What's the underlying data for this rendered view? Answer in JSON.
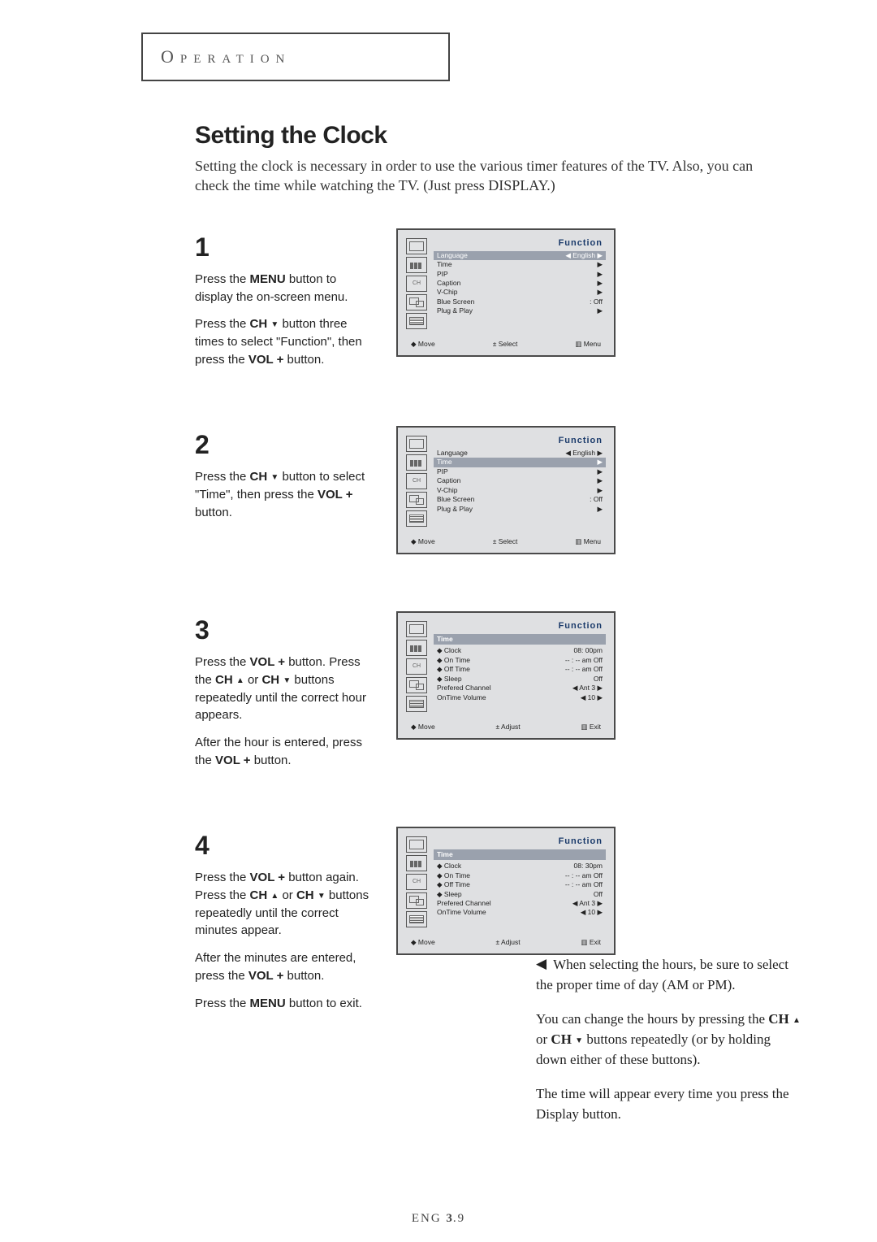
{
  "section_header": "Operation",
  "title": "Setting the Clock",
  "intro": "Setting the clock is necessary in order to use the various timer features of the TV. Also, you can check the time while watching the TV.  (Just press DISPLAY.)",
  "steps": {
    "s1": {
      "num": "1",
      "p1a": "Press the ",
      "menu": "MENU",
      "p1b": " button to display the on-screen menu.",
      "p2a": "Press the ",
      "ch": "CH ",
      "p2b": " button three times to select \"Function\",  then press the ",
      "vol": "VOL +",
      "p2c": " button."
    },
    "s2": {
      "num": "2",
      "p1a": "Press the ",
      "ch": "CH ",
      "p1b": " button to select \"Time\", then press the ",
      "vol": "VOL +",
      "p1c": " button."
    },
    "s3": {
      "num": "3",
      "p1a": "Press the ",
      "vol1": "VOL +",
      "p1b": " button. Press the ",
      "chup": "CH ",
      "or": " or ",
      "chdn": "CH ",
      "p1c": " buttons repeatedly until the correct hour appears.",
      "p2a": "After the hour is entered, press the ",
      "vol2": "VOL +",
      "p2b": " button."
    },
    "s4": {
      "num": "4",
      "p1a": "Press the ",
      "vol1": "VOL +",
      "p1b": " button again. Press the ",
      "chup": "CH ",
      "or": " or ",
      "chdn": "CH ",
      "p1c": " buttons repeatedly until the correct minutes appear.",
      "p2a": "After the minutes are entered, press the ",
      "vol2": "VOL +",
      "p2b": " button.",
      "p3a": "Press the ",
      "menu": "MENU",
      "p3b": " button to exit."
    }
  },
  "osd": {
    "title": "Function",
    "rows_fn": {
      "language": {
        "l": "Language",
        "r": "◀ English ▶"
      },
      "time": {
        "l": "Time",
        "r": "▶"
      },
      "pip": {
        "l": "PIP",
        "r": "▶"
      },
      "caption": {
        "l": "Caption",
        "r": "▶"
      },
      "vchip": {
        "l": "V-Chip",
        "r": "▶"
      },
      "blue": {
        "l": "Blue Screen",
        "r": ": Off"
      },
      "plug": {
        "l": "Plug & Play",
        "r": "▶"
      }
    },
    "time_sub": "Time",
    "rows_time_3": {
      "clock": {
        "l": "◆ Clock",
        "r": "08: 00pm"
      },
      "ontime": {
        "l": "◆ On Time",
        "r": "-- : -- am  Off"
      },
      "offtime": {
        "l": "◆ Off Time",
        "r": "-- : -- am  Off"
      },
      "sleep": {
        "l": "◆ Sleep",
        "r": "Off"
      },
      "pref": {
        "l": "Prefered Channel",
        "r": "◀ Ant 3 ▶"
      },
      "onvol": {
        "l": "OnTime Volume",
        "r": "◀  10  ▶"
      }
    },
    "rows_time_4": {
      "clock": {
        "l": "◆ Clock",
        "r": "08: 30pm"
      },
      "ontime": {
        "l": "◆ On Time",
        "r": "-- : -- am  Off"
      },
      "offtime": {
        "l": "◆ Off Time",
        "r": "-- : -- am  Off"
      },
      "sleep": {
        "l": "◆ Sleep",
        "r": "Off"
      },
      "pref": {
        "l": "Prefered Channel",
        "r": "◀ Ant 3 ▶"
      },
      "onvol": {
        "l": "OnTime Volume",
        "r": "◀  10  ▶"
      }
    },
    "foot_menu": {
      "a": "◆ Move",
      "b": "± Select",
      "c": "▥ Menu"
    },
    "foot_exit": {
      "a": "◆ Move",
      "b": "± Adjust",
      "c": "▥ Exit"
    }
  },
  "sidenote": {
    "p1a": "When selecting the hours, be sure to select the proper time of day (AM or PM).",
    "p2a": "You can change the hours by pressing the ",
    "chup": "CH ",
    "or": " or ",
    "chdn": "CH ",
    "p2b": " buttons repeatedly (or by holding down either of these buttons).",
    "p3": "The time will appear every time you press the Display button."
  },
  "footer": {
    "eng": "ENG ",
    "chap": "3",
    "page": ".9"
  },
  "glyph": {
    "up": "▲",
    "down": "▼",
    "left": "◀"
  }
}
